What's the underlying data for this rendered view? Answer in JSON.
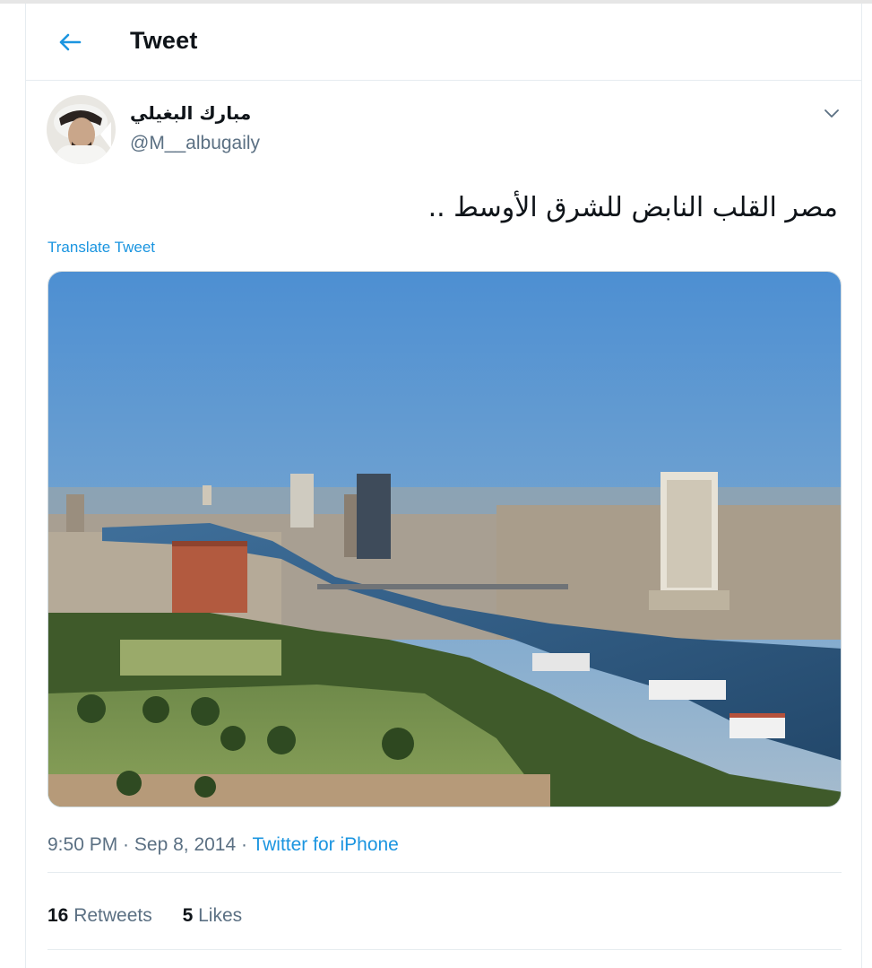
{
  "header": {
    "title": "Tweet",
    "back_icon": "arrow-left-icon"
  },
  "author": {
    "name": "مبارك البغيلي",
    "handle": "@M__albugaily",
    "avatar": "avatar"
  },
  "tweet": {
    "text": "مصر القلب النابض للشرق الأوسط ..",
    "translate_label": "Translate Tweet",
    "media": "cairo-nile-skyline-photo"
  },
  "meta": {
    "time": "9:50 PM",
    "sep1": " · ",
    "date": "Sep 8, 2014",
    "sep2": " · ",
    "source": "Twitter for iPhone"
  },
  "stats": {
    "retweets_count": "16",
    "retweets_label": "Retweets",
    "likes_count": "5",
    "likes_label": "Likes"
  },
  "colors": {
    "accent": "#1b95e0",
    "secondary_text": "#5b7083",
    "divider": "#e6ecf0"
  }
}
